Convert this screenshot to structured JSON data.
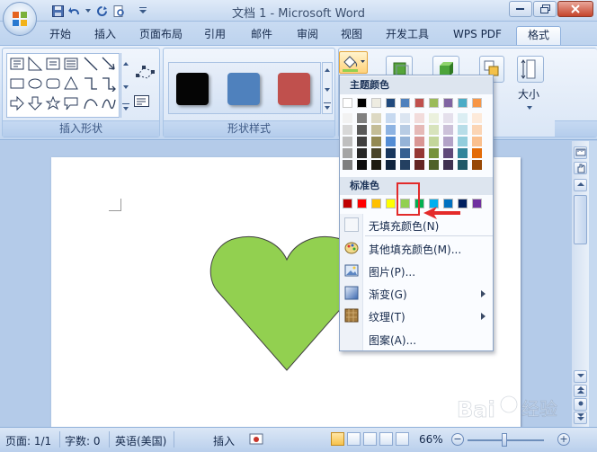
{
  "window": {
    "title": "文档 1 - Microsoft Word"
  },
  "tabs": [
    {
      "label": "开始",
      "active": false
    },
    {
      "label": "插入",
      "active": false
    },
    {
      "label": "页面布局",
      "active": false
    },
    {
      "label": "引用",
      "active": false
    },
    {
      "label": "邮件",
      "active": false
    },
    {
      "label": "审阅",
      "active": false
    },
    {
      "label": "视图",
      "active": false
    },
    {
      "label": "开发工具",
      "active": false
    },
    {
      "label": "WPS PDF",
      "active": false
    },
    {
      "label": "格式",
      "active": true
    }
  ],
  "ribbon": {
    "insert_shapes_label": "插入形状",
    "shape_styles_label": "形状样式",
    "size_label": "大小",
    "style_swatches": [
      "#050505",
      "#4f81bd",
      "#c0504d"
    ]
  },
  "fill_menu": {
    "theme_colors_header": "主题颜色",
    "standard_colors_header": "标准色",
    "theme_top_row": [
      "#ffffff",
      "#000000",
      "#eeece1",
      "#1f497d",
      "#4f81bd",
      "#c0504d",
      "#9bbb59",
      "#8064a2",
      "#4bacc6",
      "#f79646"
    ],
    "theme_shades": [
      [
        "#f2f2f2",
        "#d8d8d8",
        "#bfbfbf",
        "#a5a5a5",
        "#7f7f7f"
      ],
      [
        "#7f7f7f",
        "#595959",
        "#3f3f3f",
        "#262626",
        "#0c0c0c"
      ],
      [
        "#ddd9c3",
        "#c4bd97",
        "#938953",
        "#494429",
        "#1d1b10"
      ],
      [
        "#c6d9f0",
        "#8db3e2",
        "#548dd4",
        "#17365d",
        "#0f243e"
      ],
      [
        "#dbe5f1",
        "#b8cce4",
        "#95b3d7",
        "#366092",
        "#244061"
      ],
      [
        "#f2dcdb",
        "#e5b9b7",
        "#d99694",
        "#953734",
        "#632423"
      ],
      [
        "#ebf1dd",
        "#d7e3bc",
        "#c3d69b",
        "#76923c",
        "#4f6128"
      ],
      [
        "#e5e0ec",
        "#ccc1d9",
        "#b2a2c7",
        "#5f497a",
        "#3f3151"
      ],
      [
        "#dbeef3",
        "#b7dde8",
        "#92cddc",
        "#31859b",
        "#205867"
      ],
      [
        "#fdeada",
        "#fbd5b5",
        "#fac08f",
        "#e36c09",
        "#974806"
      ]
    ],
    "standard_colors": [
      "#c00000",
      "#ff0000",
      "#ffc000",
      "#ffff00",
      "#92d050",
      "#00b050",
      "#00b0f0",
      "#0070c0",
      "#002060",
      "#7030a0"
    ],
    "items": [
      {
        "label": "无填充颜色(N)",
        "submenu": false
      },
      {
        "label": "其他填充颜色(M)...",
        "submenu": false
      },
      {
        "label": "图片(P)...",
        "submenu": false
      },
      {
        "label": "渐变(G)",
        "submenu": true
      },
      {
        "label": "纹理(T)",
        "submenu": true
      },
      {
        "label": "图案(A)...",
        "submenu": false
      }
    ]
  },
  "document": {
    "heart_color": "#92d050"
  },
  "statusbar": {
    "page": "页面: 1/1",
    "words": "字数: 0",
    "language": "英语(美国)",
    "insert_mode": "插入",
    "zoom": "66%"
  },
  "watermark": {
    "text": "Bai 经验",
    "url": "jingyan.baidu.com"
  }
}
